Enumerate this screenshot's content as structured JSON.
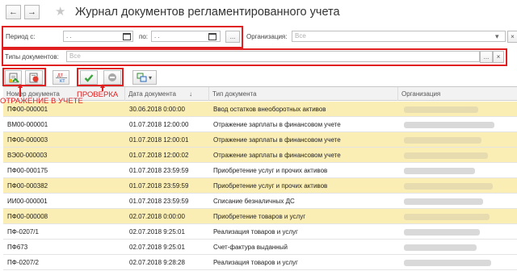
{
  "window": {
    "title": "Журнал документов регламентированного учета"
  },
  "nav": {
    "back": "←",
    "forward": "→",
    "favorite": "★"
  },
  "filters": {
    "period_label": "Период с:",
    "period_from_value": ".  .",
    "period_to_label": "по:",
    "period_to_value": ".  .",
    "period_choose": "...",
    "org_label": "Организация:",
    "org_placeholder": "Все",
    "org_clear": "×",
    "doc_types_label": "Типы документов:",
    "doc_types_placeholder": "Все",
    "doc_types_choose": "...",
    "doc_types_clear": "×"
  },
  "toolbar": {
    "dtkt_top": "ДТ",
    "dtkt_bottom": "КТ",
    "more": "▾"
  },
  "annotations": {
    "reflect": "ОТРАЖЕНИЕ В УЧЕТЕ",
    "check": "ПРОВЕРКА"
  },
  "colors": {
    "highlight": "#fbeeb4",
    "annotation": "#e02020",
    "check_green": "#39a33c"
  },
  "table": {
    "columns": [
      {
        "label": "Номер документа"
      },
      {
        "label": "Дата документа",
        "sort": "↓"
      },
      {
        "label": "Тип документа"
      },
      {
        "label": "Организация"
      }
    ],
    "rows": [
      {
        "number": "ПФ00-000001",
        "date": "30.06.2018 0:00:00",
        "type": "Ввод остатков внеоборотных активов",
        "highlight": true
      },
      {
        "number": "ВМ00-000001",
        "date": "01.07.2018 12:00:00",
        "type": "Отражение зарплаты в финансовом учете",
        "highlight": false
      },
      {
        "number": "ПФ00-000003",
        "date": "01.07.2018 12:00:01",
        "type": "Отражение зарплаты в финансовом учете",
        "highlight": true
      },
      {
        "number": "ВЭ00-000003",
        "date": "01.07.2018 12:00:02",
        "type": "Отражение зарплаты в финансовом учете",
        "highlight": true
      },
      {
        "number": "ПФ00-000175",
        "date": "01.07.2018 23:59:59",
        "type": "Приобретение услуг и прочих активов",
        "highlight": false
      },
      {
        "number": "ПФ00-000382",
        "date": "01.07.2018 23:59:59",
        "type": "Приобретение услуг и прочих активов",
        "highlight": true
      },
      {
        "number": "ИИ00-000001",
        "date": "01.07.2018 23:59:59",
        "type": "Списание безналичных ДС",
        "highlight": false
      },
      {
        "number": "ПФ00-000008",
        "date": "02.07.2018 0:00:00",
        "type": "Приобретение товаров и услуг",
        "highlight": true
      },
      {
        "number": "ПФ-0207/1",
        "date": "02.07.2018 9:25:01",
        "type": "Реализация товаров и услуг",
        "highlight": false
      },
      {
        "number": "ПФ673",
        "date": "02.07.2018 9:25:01",
        "type": "Счет-фактура выданный",
        "highlight": false
      },
      {
        "number": "ПФ-0207/2",
        "date": "02.07.2018 9:28:28",
        "type": "Реализация товаров и услуг",
        "highlight": false
      }
    ]
  }
}
